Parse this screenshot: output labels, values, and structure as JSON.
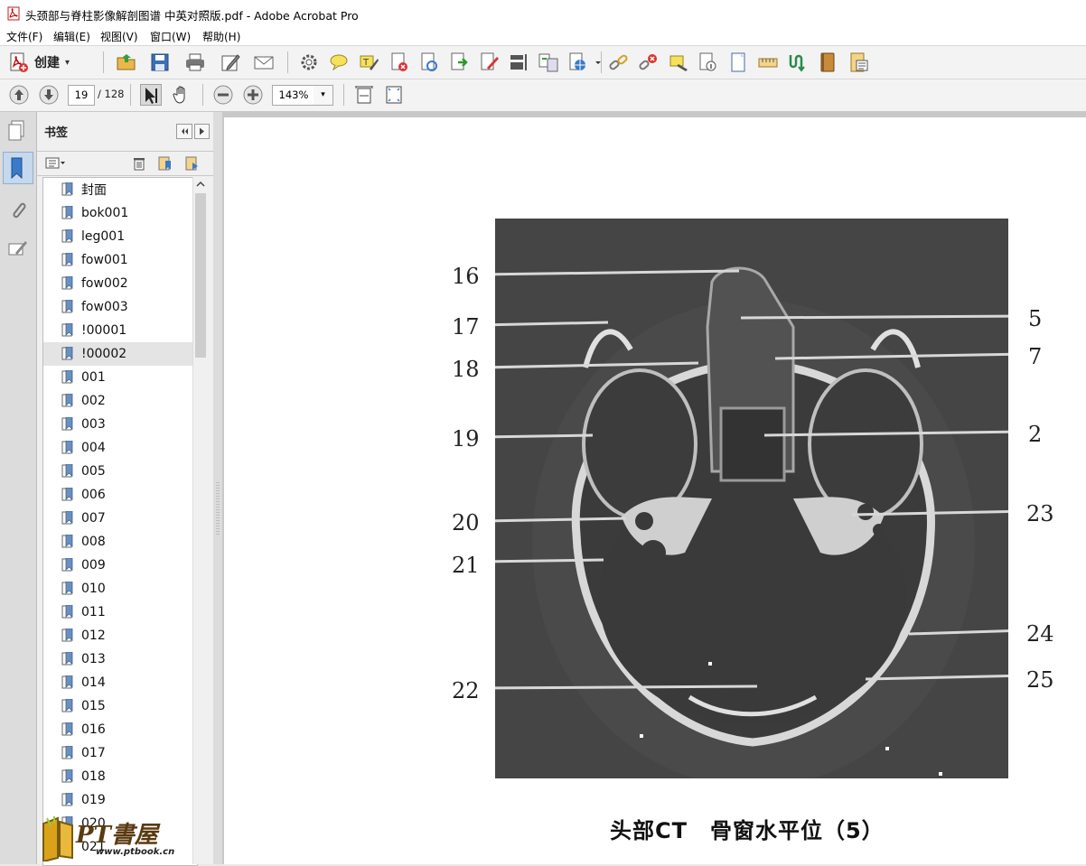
{
  "window": {
    "title": "头颈部与脊柱影像解剖图谱 中英对照版.pdf - Adobe Acrobat Pro"
  },
  "menu": {
    "items": [
      "文件(F)",
      "编辑(E)",
      "视图(V)",
      "窗口(W)",
      "帮助(H)"
    ]
  },
  "toolbar": {
    "create_label": "创建",
    "create_dropdown": "▾",
    "icons": [
      "open-folder-icon",
      "save-icon",
      "print-icon",
      "edit-icon",
      "email-icon",
      "settings-icon",
      "comment-icon",
      "highlight-icon",
      "delete-icon",
      "refresh-icon",
      "export-icon",
      "edit-text-icon",
      "align-icon",
      "compare-icon",
      "web-icon",
      "link-icon",
      "unlink-icon",
      "stamp-icon",
      "info-icon",
      "page-icon",
      "ruler-icon",
      "tool-icon",
      "book-icon",
      "form-icon"
    ]
  },
  "nav": {
    "current_page": "19",
    "total_pages": "/ 128",
    "zoom": "143%",
    "zoom_dropdown": "▾"
  },
  "panel": {
    "title": "书签",
    "options_icon": "options-icon",
    "bookmarks": [
      {
        "label": "封面"
      },
      {
        "label": "bok001"
      },
      {
        "label": "leg001"
      },
      {
        "label": "fow001"
      },
      {
        "label": "fow002"
      },
      {
        "label": "fow003"
      },
      {
        "label": "!00001"
      },
      {
        "label": "!00002",
        "selected": true
      },
      {
        "label": "001"
      },
      {
        "label": "002"
      },
      {
        "label": "003"
      },
      {
        "label": "004"
      },
      {
        "label": "005"
      },
      {
        "label": "006"
      },
      {
        "label": "007"
      },
      {
        "label": "008"
      },
      {
        "label": "009"
      },
      {
        "label": "010"
      },
      {
        "label": "011"
      },
      {
        "label": "012"
      },
      {
        "label": "013"
      },
      {
        "label": "014"
      },
      {
        "label": "015"
      },
      {
        "label": "016"
      },
      {
        "label": "017"
      },
      {
        "label": "018"
      },
      {
        "label": "019"
      },
      {
        "label": "020"
      },
      {
        "label": "021"
      }
    ]
  },
  "document": {
    "labels_left": [
      "16",
      "17",
      "18",
      "19",
      "20",
      "21",
      "22"
    ],
    "labels_right": [
      "5",
      "7",
      "2",
      "23",
      "24",
      "25"
    ],
    "caption": "头部CT　骨窗水平位（5）"
  },
  "watermark": {
    "text": "PT書屋",
    "url": "www.ptbook.cn"
  }
}
